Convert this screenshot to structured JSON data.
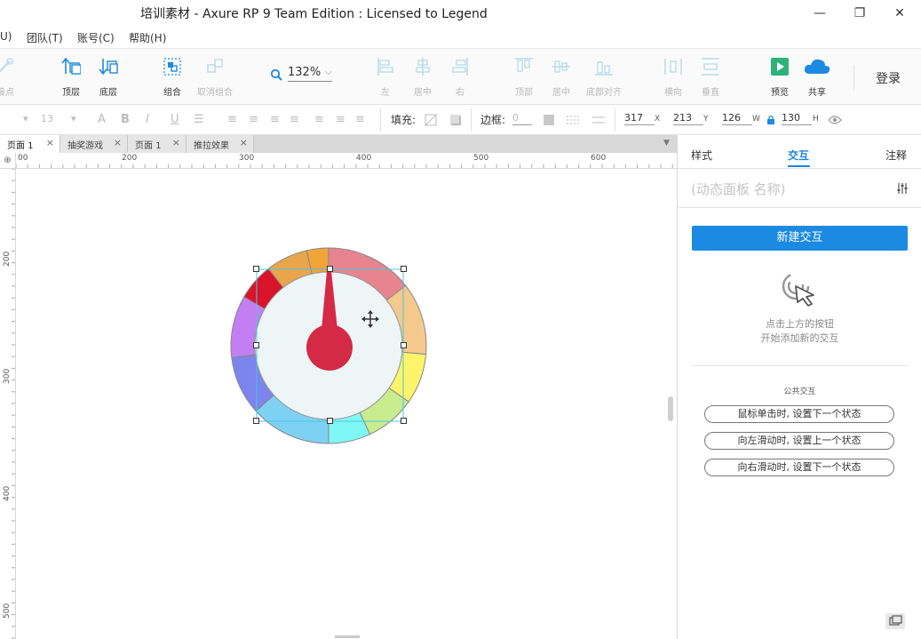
{
  "window": {
    "title": "培训素材 - Axure RP 9 Team Edition : Licensed to Legend",
    "minimize": "—",
    "maximize": "❐",
    "close": "✕"
  },
  "menu": {
    "items": [
      {
        "label": "U)"
      },
      {
        "label": "团队(T)"
      },
      {
        "label": "账号(C)"
      },
      {
        "label": "帮助(H)"
      }
    ]
  },
  "toolbar": {
    "point_label": "连接点",
    "top_layer": "顶层",
    "bottom_layer": "底层",
    "group": "组合",
    "ungroup": "取消组合",
    "zoom": "132%",
    "align_left": "左",
    "align_center": "居中",
    "align_right": "右",
    "align_top": "顶部",
    "align_middle": "居中",
    "align_bottom": "底部对齐",
    "distribute_h": "横向",
    "distribute_v": "垂直",
    "preview": "预览",
    "share": "共享",
    "login": "登录",
    "accent_color": "#1b8ae0",
    "preview_color": "#2db37a"
  },
  "format": {
    "font_size": "13",
    "fill_label": "填充:",
    "border_label": "边框:",
    "border_value": "0",
    "x": "317",
    "x_label": "X",
    "y": "213",
    "y_label": "Y",
    "w": "126",
    "w_label": "W",
    "h": "130",
    "h_label": "H"
  },
  "tabs": [
    {
      "label": "页面 1",
      "active": true
    },
    {
      "label": "抽奖游戏",
      "active": false
    },
    {
      "label": "页面 1",
      "active": false
    },
    {
      "label": "推拉效果",
      "active": false
    }
  ],
  "ruler": {
    "top": [
      "00",
      "200",
      "300",
      "400",
      "500",
      "600"
    ],
    "left": [
      "200",
      "300",
      "400",
      "500"
    ]
  },
  "panel": {
    "tabs": [
      "样式",
      "交互",
      "注释"
    ],
    "active_tab": "交互",
    "widget_name_placeholder": "(动态面板 名称)",
    "new_interaction": "新建交互",
    "hint_line1": "点击上方的按钮",
    "hint_line2": "开始添加新的交互",
    "public_title": "公共交互",
    "public_items": [
      "鼠标单击时, 设置下一个状态",
      "向左滑动时, 设置上一个状态",
      "向右滑动时, 设置下一个状态"
    ]
  },
  "dial": {
    "segment_colors": [
      "#e8848f",
      "#f4c98e",
      "#fdf46b",
      "#c8ec8e",
      "#7ff7f5",
      "#7dd2f3",
      "#7c84ee",
      "#c37ef3",
      "#d8132a",
      "#e9a54c",
      "#f2a43a"
    ],
    "face_color": "#eef5f7",
    "needle_color": "#d42a45"
  }
}
